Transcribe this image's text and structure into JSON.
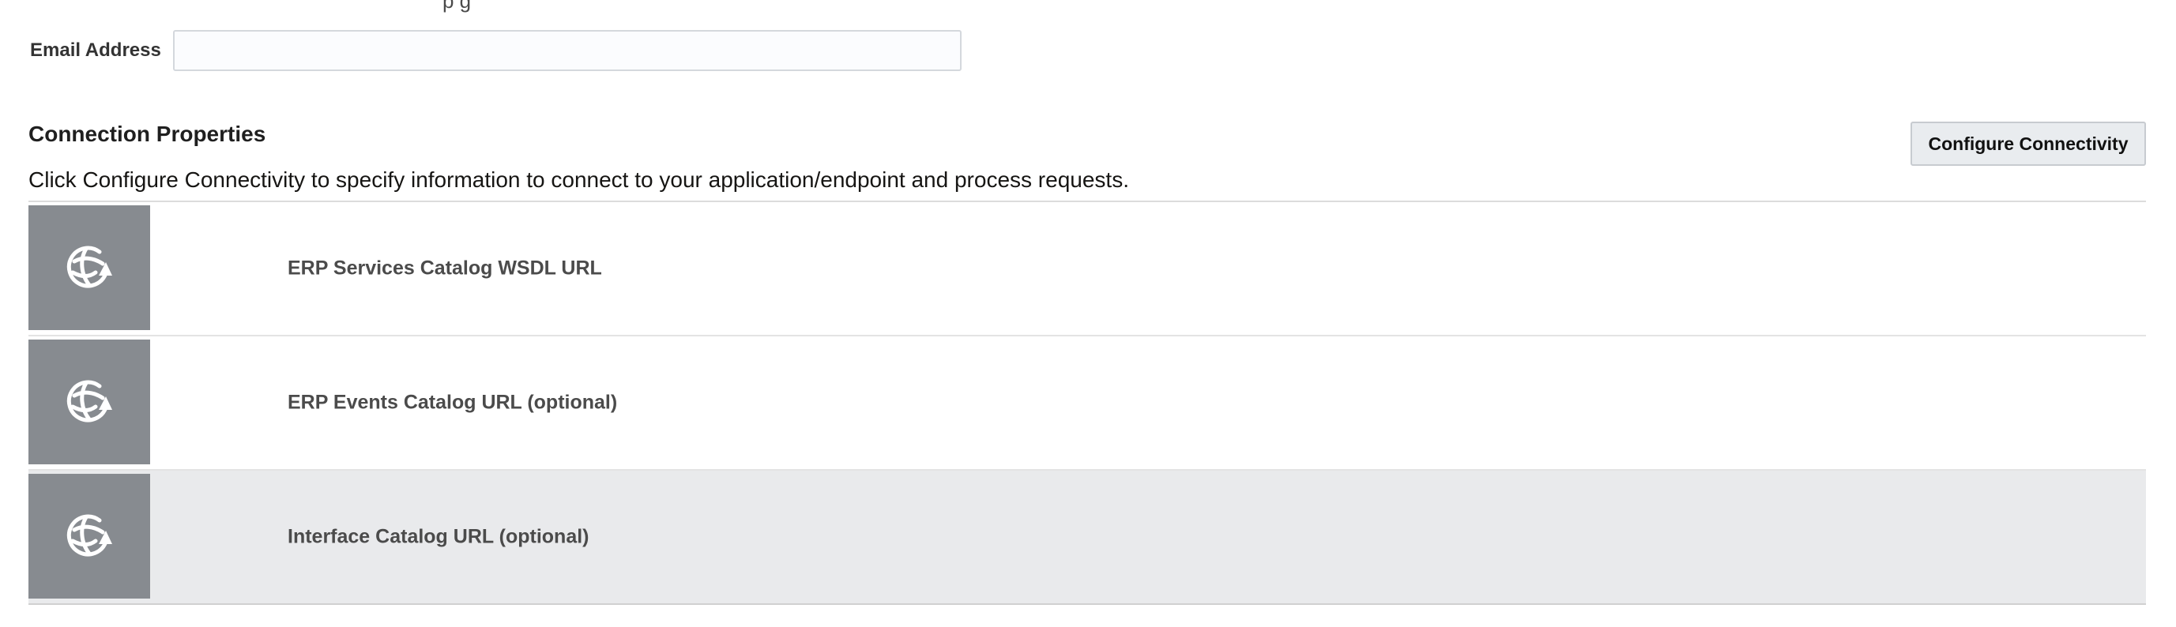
{
  "header": {
    "partial_text": "p          g"
  },
  "email": {
    "label": "Email Address",
    "value": "",
    "placeholder": ""
  },
  "connection_properties": {
    "title": "Connection Properties",
    "description": "Click Configure Connectivity to specify information to connect to your application/endpoint and process requests.",
    "configure_button_label": "Configure Connectivity",
    "items": [
      {
        "label": "ERP Services Catalog WSDL URL",
        "icon": "globe-refresh-icon"
      },
      {
        "label": "ERP Events Catalog URL (optional)",
        "icon": "globe-refresh-icon"
      },
      {
        "label": "Interface Catalog URL (optional)",
        "icon": "globe-refresh-icon"
      }
    ],
    "active_index": 2
  },
  "colors": {
    "tile_bg": "#878b90",
    "active_row_bg": "#e9eaec",
    "button_bg": "#e9ecef"
  }
}
